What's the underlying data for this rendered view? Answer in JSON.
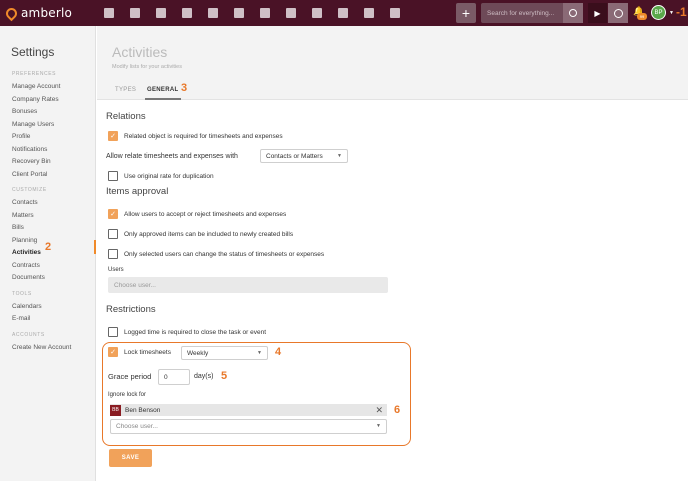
{
  "topbar": {
    "logo_text": "amberlo",
    "nav_icons": [
      "dashboard-icon",
      "contacts-icon",
      "matters-icon",
      "bills-icon",
      "bank-icon",
      "calendar-icon",
      "activities-icon",
      "discounts-icon",
      "folder-icon",
      "documents-icon",
      "mail-icon",
      "reports-icon"
    ],
    "add_label": "+",
    "search_placeholder": "Search for everything...",
    "notification_count": "99",
    "avatar_initials": "BP",
    "step_marker": "-1"
  },
  "sidebar": {
    "title": "Settings",
    "sections": [
      {
        "label": "PREFERENCES",
        "items": [
          "Manage Account",
          "Company Rates",
          "Bonuses",
          "Manage Users",
          "Profile",
          "Notifications",
          "Recovery Bin",
          "Client Portal"
        ]
      },
      {
        "label": "CUSTOMIZE",
        "items": [
          "Contacts",
          "Matters",
          "Bills",
          "Planning",
          "Activities",
          "Contracts",
          "Documents"
        ]
      },
      {
        "label": "TOOLS",
        "items": [
          "Calendars",
          "E-mail"
        ]
      },
      {
        "label": "ACCOUNTS",
        "items": [
          "Create New Account"
        ]
      }
    ],
    "active_item": "Activities",
    "step_marker": "2"
  },
  "header": {
    "title": "Activities",
    "subtitle": "Modify lists for your activities"
  },
  "tabs": {
    "items": [
      "TYPES",
      "GENERAL"
    ],
    "active": "GENERAL",
    "step_marker": "3"
  },
  "relations": {
    "title": "Relations",
    "related_object_label": "Related object is required for timesheets and expenses",
    "related_object_checked": true,
    "allow_relate_label": "Allow relate timesheets and expenses with",
    "allow_relate_value": "Contacts or Matters",
    "original_rate_label": "Use original rate for duplication",
    "original_rate_checked": false
  },
  "items_approval": {
    "title": "Items approval",
    "allow_accept_label": "Allow users to accept or reject timesheets and expenses",
    "allow_accept_checked": true,
    "only_approved_label": "Only approved items can be included to newly created bills",
    "only_approved_checked": false,
    "only_selected_label": "Only selected users can change the status of timesheets or expenses",
    "only_selected_checked": false,
    "users_label": "Users",
    "users_placeholder": "Choose user..."
  },
  "restrictions": {
    "title": "Restrictions",
    "logged_time_label": "Logged time is required to close the task or event",
    "logged_time_checked": false,
    "lock_timesheets_label": "Lock timesheets",
    "lock_timesheets_checked": true,
    "lock_period_value": "Weekly",
    "lock_step_marker": "4",
    "grace_period_label": "Grace period",
    "grace_period_value": "0",
    "grace_period_unit": "day(s)",
    "grace_step_marker": "5",
    "ignore_lock_label": "Ignore lock for",
    "ignore_user_initials": "BB",
    "ignore_user_name": "Ben Benson",
    "ignore_remove": "✕",
    "ignore_placeholder": "Choose user...",
    "ignore_step_marker": "6"
  },
  "save_label": "SAVE",
  "colors": {
    "topbar": "#4a1226",
    "accent": "#f08a2a",
    "marker": "#e8782a",
    "checkbox_checked": "#f1a25a"
  }
}
